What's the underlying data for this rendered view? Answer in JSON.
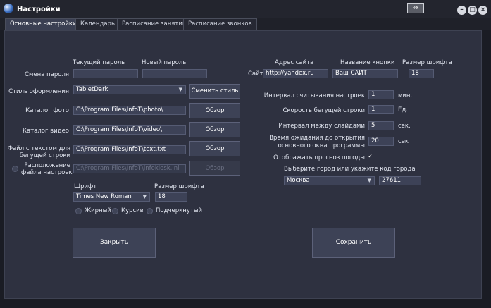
{
  "window": {
    "title": "Настройки",
    "restore_icon": "⇔",
    "minimize": "–",
    "maximize": "□",
    "close": "×"
  },
  "tabs": [
    {
      "label": "Основные настройки",
      "active": true
    },
    {
      "label": "Календарь"
    },
    {
      "label": "Расписание занятий"
    },
    {
      "label": "Расписание звонков"
    }
  ],
  "password": {
    "current_header": "Текущий пароль",
    "new_header": "Новый пароль",
    "label": "Смена пароля",
    "current_value": "",
    "new_value": ""
  },
  "style": {
    "label": "Стиль оформления",
    "value": "TabletDark",
    "button": "Сменить стиль"
  },
  "photo": {
    "label": "Каталог фото",
    "value": "C:\\Program Files\\InfoT\\photo\\",
    "button": "Обзор"
  },
  "video": {
    "label": "Каталог видео",
    "value": "C:\\Program Files\\InfoT\\video\\",
    "button": "Обзор"
  },
  "text_file": {
    "label_line1": "Файл с текстом для",
    "label_line2": "бегущей строки",
    "value": "C:\\Program Files\\InfoT\\text.txt",
    "button": "Обзор"
  },
  "settings_file": {
    "label_line1": "Расположение",
    "label_line2": "файла настроек",
    "value": "C:\\Program Files\\InfoT\\infokiosk.ini",
    "button": "Обзор"
  },
  "font": {
    "label": "Шрифт",
    "value": "Times New Roman",
    "size_label": "Размер шрифта",
    "size_value": "18",
    "bold": "Жирный",
    "italic": "Курсив",
    "underline": "Подчеркнутый"
  },
  "site": {
    "address_header": "Адрес сайта",
    "button_name_header": "Название кнопки",
    "font_size_header": "Размер шрифта",
    "label": "Сайт",
    "address": "http://yandex.ru",
    "button_name": "Ваш САЙТ",
    "font_size": "18"
  },
  "intervals": {
    "read_label": "Интервал считывания настроек",
    "read_value": "1",
    "read_unit": "мин.",
    "ticker_label": "Скорость бегущей строки",
    "ticker_value": "1",
    "ticker_unit": "Ед.",
    "slides_label": "Интервал между слайдами",
    "slides_value": "5",
    "slides_unit": "сек.",
    "wait_label_line1": "Время ожидания до открытия",
    "wait_label_line2": "основного окна программы",
    "wait_value": "20",
    "wait_unit": "сек"
  },
  "weather": {
    "show_label": "Отображать прогноз погоды",
    "checked_mark": "✓",
    "city_label": "Выберите город или укажите код города",
    "city": "Москва",
    "city_code": "27611"
  },
  "actions": {
    "close": "Закрыть",
    "save": "Сохранить"
  }
}
